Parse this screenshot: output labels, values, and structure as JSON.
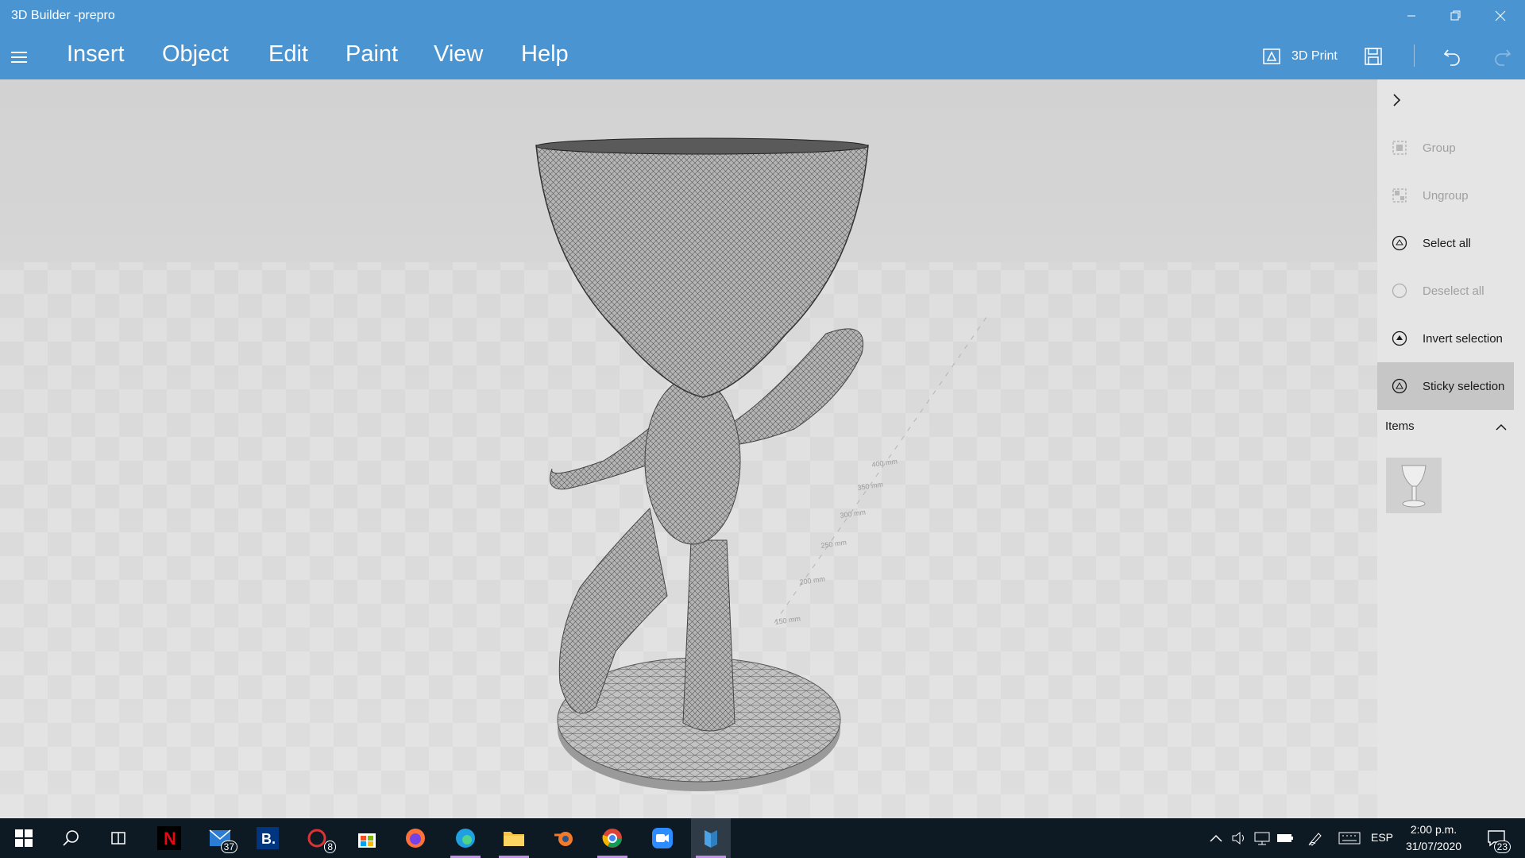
{
  "window": {
    "title": "3D Builder -prepro"
  },
  "menu": {
    "items": [
      "Insert",
      "Object",
      "Edit",
      "Paint",
      "View",
      "Help"
    ]
  },
  "toolbar": {
    "print_label": "3D Print"
  },
  "panel": {
    "items": [
      {
        "label": "Group"
      },
      {
        "label": "Ungroup"
      },
      {
        "label": "Select all"
      },
      {
        "label": "Deselect all"
      },
      {
        "label": "Invert selection"
      },
      {
        "label": "Sticky selection"
      }
    ],
    "section_label": "Items"
  },
  "viewport": {
    "ruler_labels": [
      "150 mm",
      "200 mm",
      "250 mm",
      "300 mm",
      "350 mm",
      "400 mm"
    ]
  },
  "taskbar": {
    "mail_badge": "37",
    "app_badge": "8",
    "notif_badge": "23",
    "language": "ESP",
    "time": "2:00 p.m.",
    "date": "31/07/2020"
  },
  "colors": {
    "titlebar": "#4a95d1",
    "taskbar": "#0d1a24",
    "panel": "#e5e5e5"
  }
}
